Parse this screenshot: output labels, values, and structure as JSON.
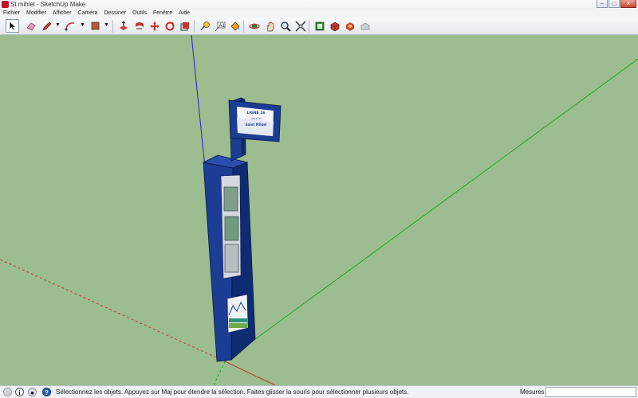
{
  "window": {
    "title": "St mihiel - SketchUp Make"
  },
  "menu": [
    "Fichier",
    "Modifier",
    "Afficher",
    "Caméra",
    "Dessiner",
    "Outils",
    "Fenêtre",
    "Aide"
  ],
  "toolbar": {
    "icons": [
      "select-icon",
      "eraser-icon",
      "pencil-icon",
      "arc-icon",
      "rectangle-icon",
      "push-pull-icon",
      "follow-me-icon",
      "move-icon",
      "rotate-icon",
      "offset-icon",
      "tape-measure-icon",
      "text-icon",
      "paint-bucket-icon",
      "orbit-icon",
      "pan-icon",
      "zoom-icon",
      "zoom-extents-icon",
      "warehouse-icon",
      "components-icon",
      "extension-icon",
      "share-model-icon"
    ],
    "selected_tool": "select-icon"
  },
  "model": {
    "sign_lines": [
      "LIGNE 16",
      "vers la",
      "Saint Mihiel"
    ]
  },
  "status": {
    "message": "Sélectionnez les objets. Appuyez sur Maj pour étendre la sélection. Faites glisser la souris pour sélectionner plusieurs objets.",
    "measure_label": "Mesures",
    "measure_value": ""
  },
  "colors": {
    "viewport_bg": "#9bbd8f",
    "post_blue": "#1b3d93",
    "axis_green": "#1fa51f",
    "axis_blue": "#2222d6",
    "axis_red": "#c43a2a"
  }
}
